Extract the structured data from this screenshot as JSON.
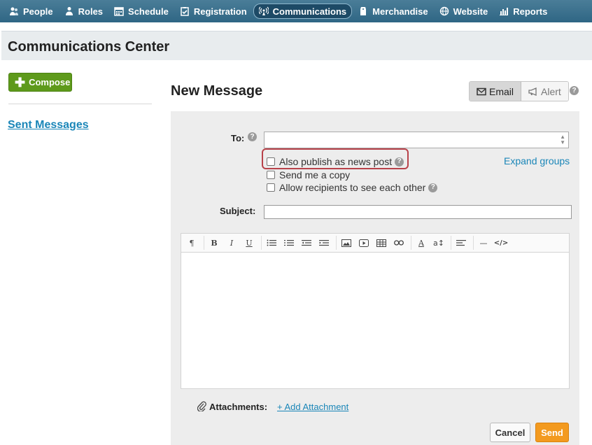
{
  "nav": {
    "items": [
      {
        "label": "People",
        "icon": "people-icon"
      },
      {
        "label": "Roles",
        "icon": "roles-icon"
      },
      {
        "label": "Schedule",
        "icon": "calendar-icon"
      },
      {
        "label": "Registration",
        "icon": "clipboard-check-icon"
      },
      {
        "label": "Communications",
        "icon": "broadcast-icon",
        "active": true
      },
      {
        "label": "Merchandise",
        "icon": "tag-icon"
      },
      {
        "label": "Website",
        "icon": "globe-icon"
      },
      {
        "label": "Reports",
        "icon": "bar-chart-icon"
      }
    ]
  },
  "page": {
    "title": "Communications Center"
  },
  "sidebar": {
    "compose_label": "Compose",
    "sent_messages_label": "Sent Messages"
  },
  "message": {
    "title": "New Message",
    "mode_email": "Email",
    "mode_alert": "Alert",
    "selected_mode": "Email",
    "to_label": "To:",
    "to_value": "",
    "options": {
      "publish_news": {
        "label": "Also publish as news post",
        "checked": false
      },
      "send_copy": {
        "label": "Send me a copy",
        "checked": false
      },
      "allow_recipients": {
        "label": "Allow recipients to see each other",
        "checked": false
      }
    },
    "expand_groups": "Expand groups",
    "subject_label": "Subject:",
    "subject_value": "",
    "attachments_label": "Attachments:",
    "add_attachment": "+ Add Attachment",
    "cancel_label": "Cancel",
    "send_label": "Send"
  },
  "colors": {
    "nav_bg": "#2f6684",
    "compose_green": "#5e9a1b",
    "link_blue": "#1a86b8",
    "send_orange": "#f39a1f",
    "highlight_red": "#b8424a"
  }
}
